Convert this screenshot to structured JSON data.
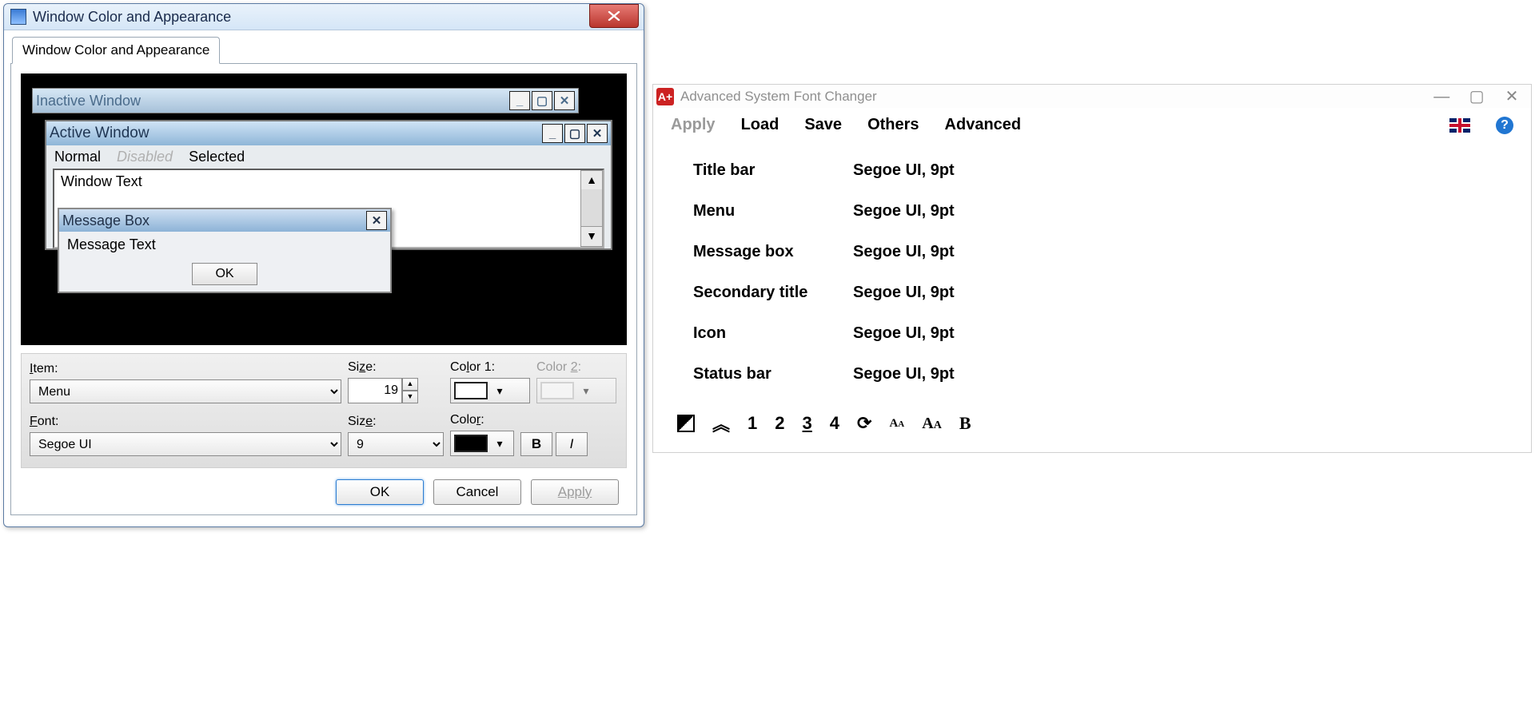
{
  "left": {
    "title": "Window Color and Appearance",
    "tab": "Window Color and Appearance",
    "preview": {
      "inactive_title": "Inactive Window",
      "active_title": "Active Window",
      "menu_normal": "Normal",
      "menu_disabled": "Disabled",
      "menu_selected": "Selected",
      "window_text": "Window Text",
      "msgbox_title": "Message Box",
      "msgbox_text": "Message Text",
      "msgbox_ok": "OK"
    },
    "labels": {
      "item": "Item:",
      "item_underline": "I",
      "size1": "Size:",
      "size1_underline": "z",
      "color1": "Color 1:",
      "color1_underline": "l",
      "color2": "Color 2:",
      "color2_underline": "2",
      "font": "Font:",
      "font_underline": "F",
      "size2": "Size:",
      "size2_underline": "E",
      "colorf": "Color:",
      "colorf_underline": "r"
    },
    "values": {
      "item": "Menu",
      "size": "19",
      "color1": "#ffffff",
      "font": "Segoe UI",
      "fsize": "9",
      "fcolor": "#000000"
    },
    "style_bold": "B",
    "style_italic": "I",
    "buttons": {
      "ok": "OK",
      "cancel": "Cancel",
      "apply": "Apply"
    }
  },
  "right": {
    "title": "Advanced System Font Changer",
    "menu": {
      "apply": "Apply",
      "load": "Load",
      "save": "Save",
      "others": "Others",
      "advanced": "Advanced"
    },
    "rows": [
      {
        "name": "Title bar",
        "val": "Segoe UI, 9pt"
      },
      {
        "name": "Menu",
        "val": "Segoe UI, 9pt"
      },
      {
        "name": "Message box",
        "val": "Segoe UI, 9pt"
      },
      {
        "name": "Secondary title",
        "val": "Segoe UI, 9pt"
      },
      {
        "name": "Icon",
        "val": "Segoe UI, 9pt"
      },
      {
        "name": "Status bar",
        "val": "Segoe UI, 9pt"
      }
    ],
    "toolbar": {
      "n1": "1",
      "n2": "2",
      "n3": "3",
      "n4": "4",
      "b": "B",
      "aa1": "A",
      "aa2": "A"
    }
  }
}
